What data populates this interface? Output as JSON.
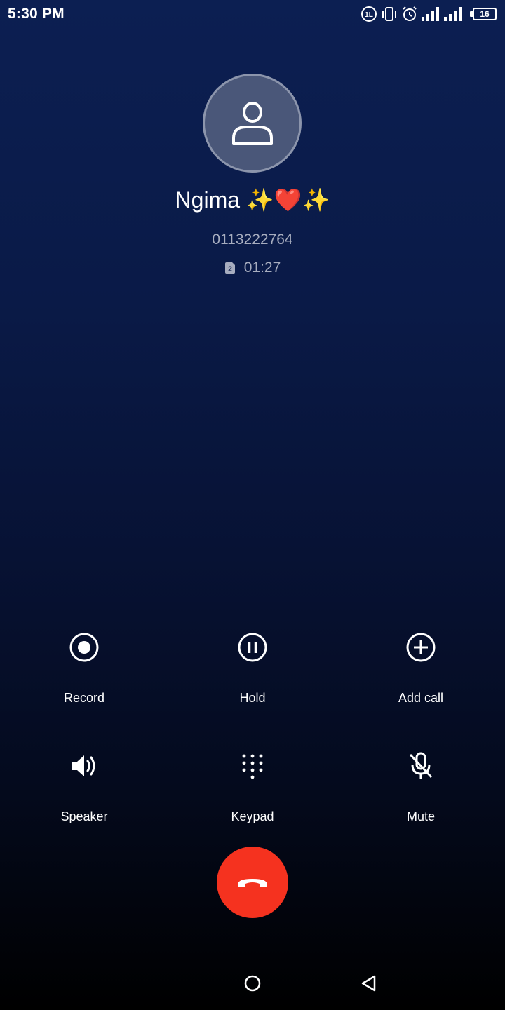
{
  "status_bar": {
    "time": "5:30 PM",
    "battery_level": "16",
    "icons": [
      "volte-icon",
      "vibrate-icon",
      "alarm-icon",
      "signal-icon",
      "signal-icon",
      "battery-icon"
    ]
  },
  "caller": {
    "name": "Ngima ✨❤️✨",
    "number": "0113222764",
    "sim_slot": "2",
    "duration": "01:27"
  },
  "controls": {
    "record_label": "Record",
    "hold_label": "Hold",
    "add_call_label": "Add call",
    "speaker_label": "Speaker",
    "keypad_label": "Keypad",
    "mute_label": "Mute"
  },
  "colors": {
    "end_call": "#f5321f",
    "background_top": "#0c1f52",
    "background_bottom": "#000000"
  },
  "nav_bar": {
    "icons": [
      "home-icon",
      "back-icon"
    ]
  }
}
